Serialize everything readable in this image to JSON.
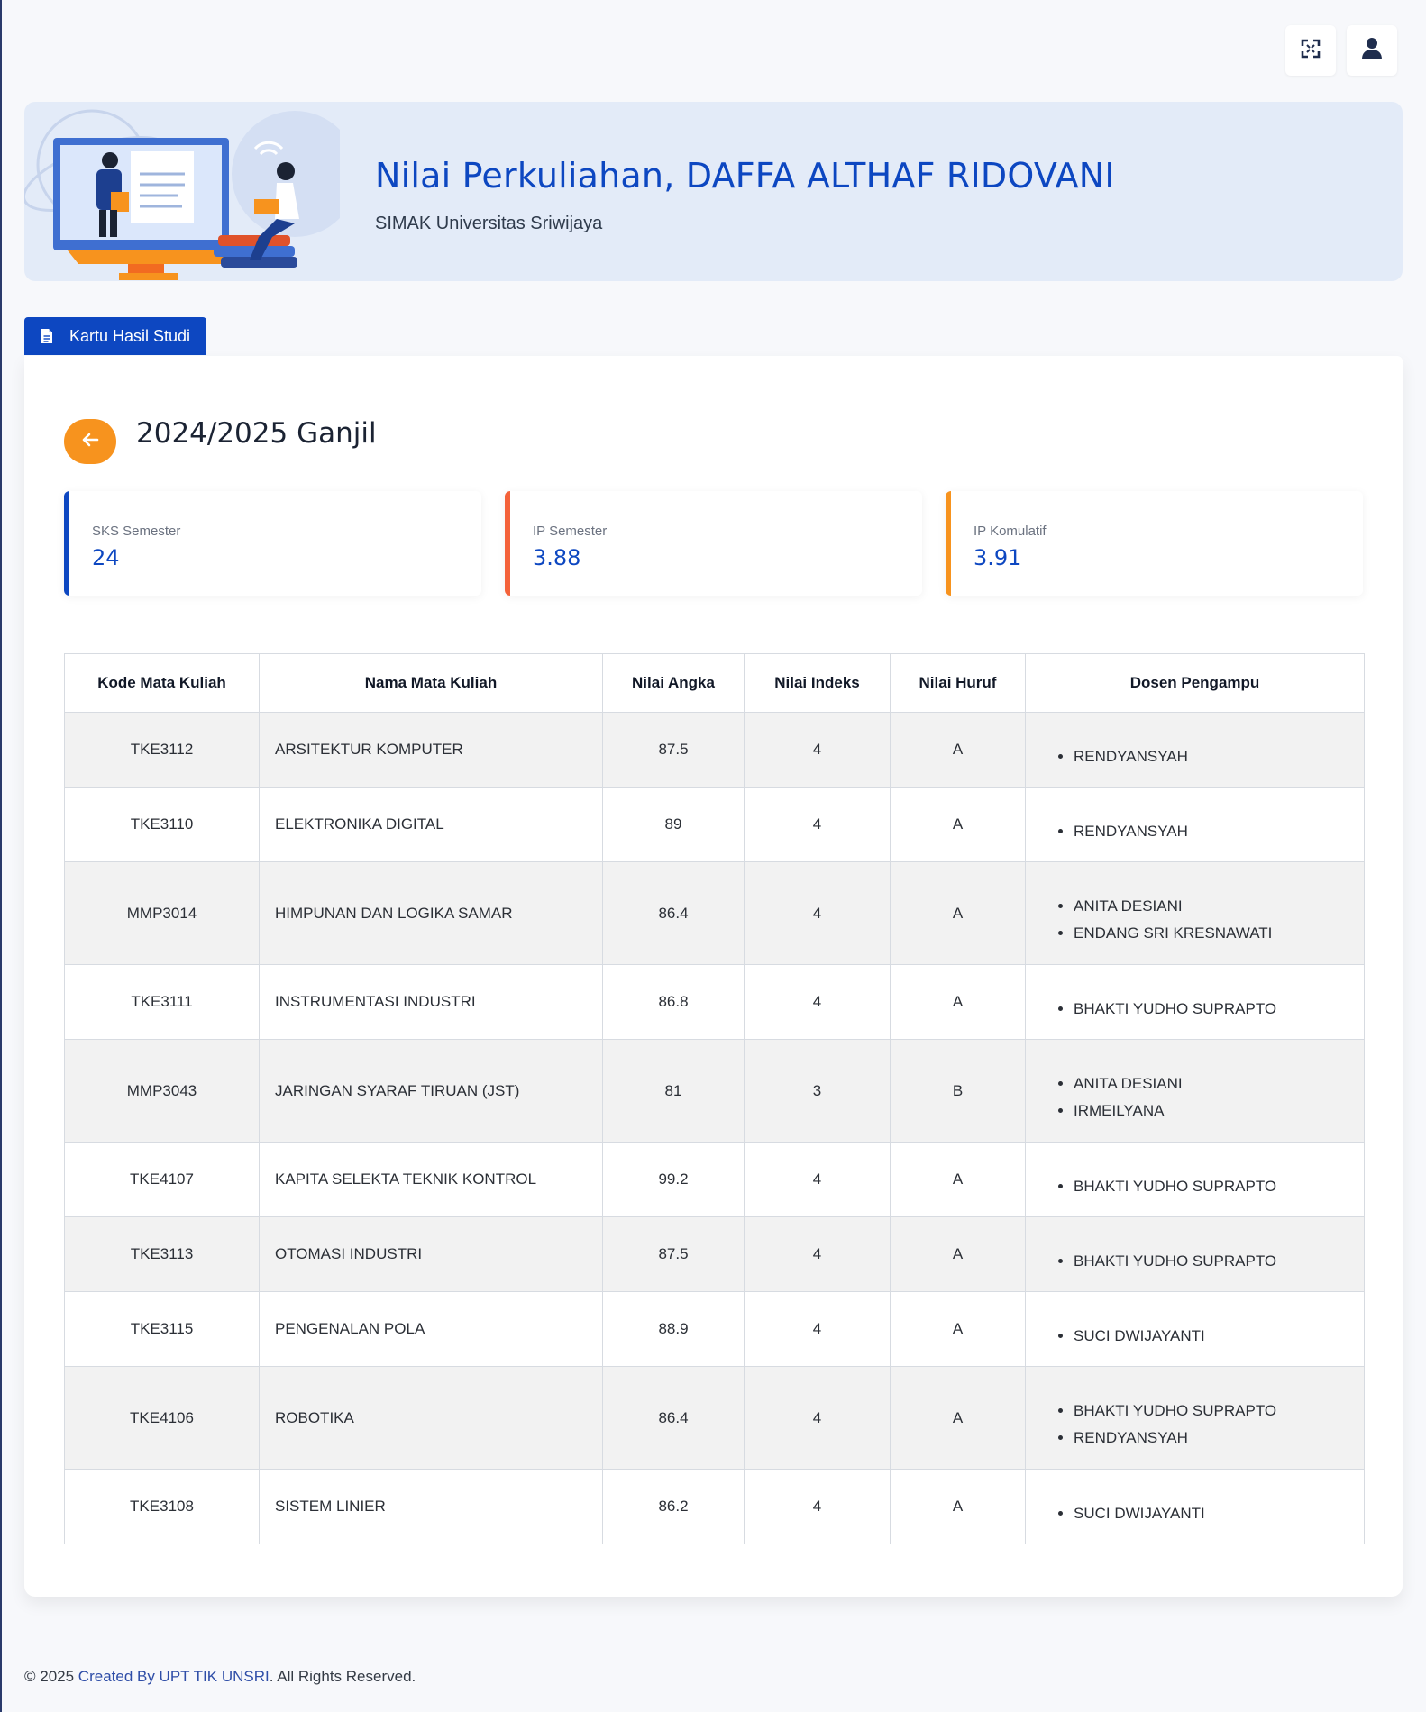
{
  "colors": {
    "primary": "#0d47c1",
    "accent_orange": "#f7931e",
    "accent_red": "#f4623a",
    "banner_bg": "#e3ebf8"
  },
  "topbar": {
    "icons": [
      "fullscreen-icon",
      "user-icon"
    ]
  },
  "banner": {
    "title": "Nilai Perkuliahan, DAFFA ALTHAF RIDOVANI",
    "subtitle": "SIMAK Universitas Sriwijaya"
  },
  "tab": {
    "label": "Kartu Hasil Studi",
    "icon": "document-icon"
  },
  "semester": {
    "title": "2024/2025 Ganjil",
    "back_icon": "arrow-left-icon"
  },
  "stats": [
    {
      "label": "SKS Semester",
      "value": "24",
      "color": "#0d47c1"
    },
    {
      "label": "IP Semester",
      "value": "3.88",
      "color": "#f4623a"
    },
    {
      "label": "IP Komulatif",
      "value": "3.91",
      "color": "#f7931e"
    }
  ],
  "table": {
    "headers": [
      "Kode Mata Kuliah",
      "Nama Mata Kuliah",
      "Nilai Angka",
      "Nilai Indeks",
      "Nilai Huruf",
      "Dosen Pengampu"
    ],
    "rows": [
      {
        "kode": "TKE3112",
        "nama": "ARSITEKTUR KOMPUTER",
        "angka": "87.5",
        "indeks": "4",
        "huruf": "A",
        "dosen": [
          "RENDYANSYAH"
        ]
      },
      {
        "kode": "TKE3110",
        "nama": "ELEKTRONIKA DIGITAL",
        "angka": "89",
        "indeks": "4",
        "huruf": "A",
        "dosen": [
          "RENDYANSYAH"
        ]
      },
      {
        "kode": "MMP3014",
        "nama": "HIMPUNAN DAN LOGIKA SAMAR",
        "angka": "86.4",
        "indeks": "4",
        "huruf": "A",
        "dosen": [
          "ANITA DESIANI",
          "ENDANG SRI KRESNAWATI"
        ]
      },
      {
        "kode": "TKE3111",
        "nama": "INSTRUMENTASI INDUSTRI",
        "angka": "86.8",
        "indeks": "4",
        "huruf": "A",
        "dosen": [
          "BHAKTI YUDHO SUPRAPTO"
        ]
      },
      {
        "kode": "MMP3043",
        "nama": "JARINGAN SYARAF TIRUAN (JST)",
        "angka": "81",
        "indeks": "3",
        "huruf": "B",
        "dosen": [
          "ANITA DESIANI",
          "IRMEILYANA"
        ]
      },
      {
        "kode": "TKE4107",
        "nama": "KAPITA SELEKTA TEKNIK KONTROL",
        "angka": "99.2",
        "indeks": "4",
        "huruf": "A",
        "dosen": [
          "BHAKTI YUDHO SUPRAPTO"
        ]
      },
      {
        "kode": "TKE3113",
        "nama": "OTOMASI INDUSTRI",
        "angka": "87.5",
        "indeks": "4",
        "huruf": "A",
        "dosen": [
          "BHAKTI YUDHO SUPRAPTO"
        ]
      },
      {
        "kode": "TKE3115",
        "nama": "PENGENALAN POLA",
        "angka": "88.9",
        "indeks": "4",
        "huruf": "A",
        "dosen": [
          "SUCI DWIJAYANTI"
        ]
      },
      {
        "kode": "TKE4106",
        "nama": "ROBOTIKA",
        "angka": "86.4",
        "indeks": "4",
        "huruf": "A",
        "dosen": [
          "BHAKTI YUDHO SUPRAPTO",
          "RENDYANSYAH"
        ]
      },
      {
        "kode": "TKE3108",
        "nama": "SISTEM LINIER",
        "angka": "86.2",
        "indeks": "4",
        "huruf": "A",
        "dosen": [
          "SUCI DWIJAYANTI"
        ]
      }
    ]
  },
  "footer": {
    "prefix": "© 2025 ",
    "link": "Created By UPT TIK UNSRI",
    "suffix": ". All Rights Reserved."
  }
}
